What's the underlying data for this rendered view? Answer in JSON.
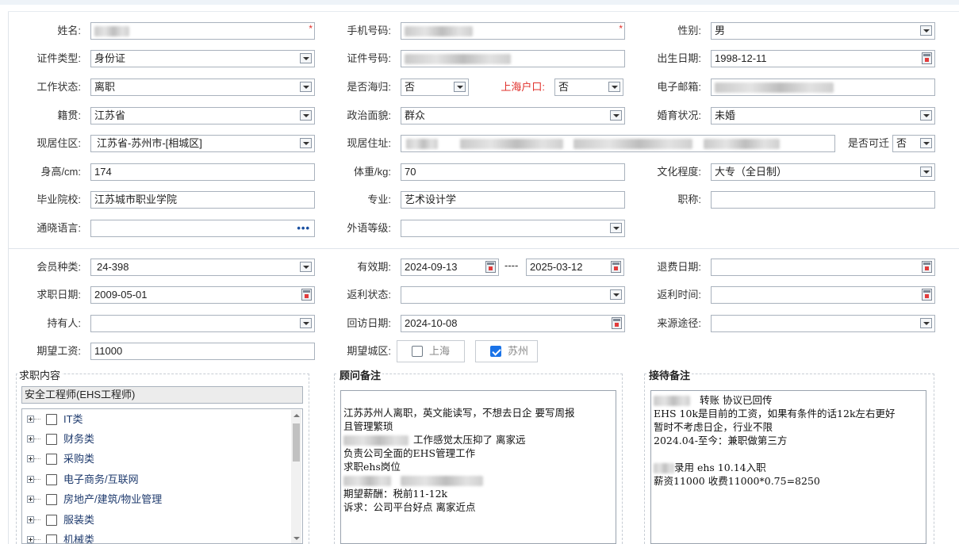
{
  "form": {
    "name_label": "姓名:",
    "phone_label": "手机号码:",
    "gender_label": "性别:",
    "gender_value": "男",
    "idtype_label": "证件类型:",
    "idtype_value": "身份证",
    "idno_label": "证件号码:",
    "birth_label": "出生日期:",
    "birth_value": "1998-12-11",
    "workstatus_label": "工作状态:",
    "workstatus_value": "离职",
    "overseas_label": "是否海归:",
    "overseas_value": "否",
    "shanghai_label": "上海户口:",
    "shanghai_value": "否",
    "email_label": "电子邮箱:",
    "native_label": "籍贯:",
    "native_value": "江苏省",
    "political_label": "政治面貌:",
    "political_value": "群众",
    "marital_label": "婚育状况:",
    "marital_value": "未婚",
    "residence_label": "现居住区:",
    "residence_value": "江苏省-苏州市-[相城区]",
    "address_label": "现居住址:",
    "relocate_label": "是否可迁",
    "relocate_value": "否",
    "height_label": "身高/cm:",
    "height_value": "174",
    "weight_label": "体重/kg:",
    "weight_value": "70",
    "education_label": "文化程度:",
    "education_value": "大专（全日制）",
    "school_label": "毕业院校:",
    "school_value": "江苏城市职业学院",
    "major_label": "专业:",
    "major_value": "艺术设计学",
    "title_label": "职称:",
    "title_value": "",
    "language_label": "通晓语言:",
    "language_value": "",
    "foreign_level_label": "外语等级:",
    "foreign_level_value": "",
    "member_type_label": "会员种类:",
    "member_type_value": "24-398",
    "valid_label": "有效期:",
    "valid_from": "2024-09-13",
    "valid_sep": "----",
    "valid_to": "2025-03-12",
    "refund_date_label": "退费日期:",
    "refund_date_value": "",
    "job_date_label": "求职日期:",
    "job_date_value": "2009-05-01",
    "rebate_status_label": "返利状态:",
    "rebate_status_value": "",
    "rebate_time_label": "返利时间:",
    "rebate_time_value": "",
    "holder_label": "持有人:",
    "holder_value": "",
    "revisit_label": "回访日期:",
    "revisit_value": "2024-10-08",
    "source_label": "来源途径:",
    "source_value": "",
    "salary_label": "期望工资:",
    "salary_value": "11000",
    "city_label": "期望城区:",
    "city_options": [
      {
        "label": "上海",
        "checked": false
      },
      {
        "label": "苏州",
        "checked": true
      }
    ]
  },
  "job_content": {
    "legend": "求职内容",
    "selected": "安全工程师(EHS工程师)",
    "tree": [
      "IT类",
      "财务类",
      "采购类",
      "电子商务/互联网",
      "房地产/建筑/物业管理",
      "服装类",
      "机械类"
    ]
  },
  "advisor_notes": {
    "legend": "顾问备注",
    "lines": [
      "江苏苏州人离职，英文能读写，不想去日企 要写周报",
      "且管理繁琐",
      "工作感觉太压抑了 离家远",
      "负责公司全面的EHS管理工作",
      "求职ehs岗位",
      "",
      "期望薪酬：税前11-12k",
      "诉求：公司平台好点 离家近点"
    ]
  },
  "reception_notes": {
    "legend": "接待备注",
    "lines": [
      "转账  协议已回传",
      "EHS  10k是目前的工资，如果有条件的话12k左右更好",
      "暂时不考虑日企，行业不限",
      "2024.04-至今：兼职做第三方",
      "",
      "录用  ehs  10.14入职",
      "薪资11000 收费11000*0.75=8250"
    ]
  }
}
